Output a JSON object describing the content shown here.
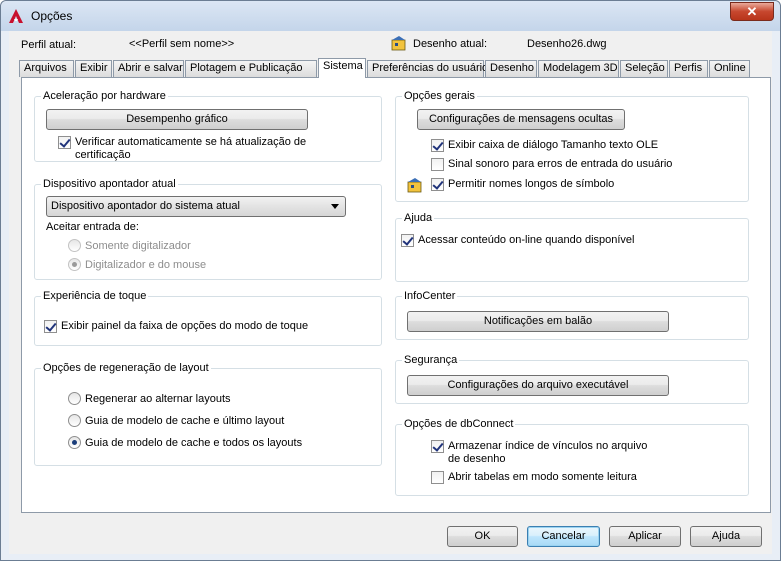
{
  "window": {
    "title": "Opções",
    "close_symbol": "✕",
    "icon": "autocad-icon"
  },
  "header": {
    "profile_label": "Perfil atual:",
    "profile_value": "<<Perfil sem nome>>",
    "drawing_label": "Desenho atual:",
    "drawing_value": "Desenho26.dwg"
  },
  "tabs": [
    {
      "label": "Arquivos"
    },
    {
      "label": "Exibir"
    },
    {
      "label": "Abrir e salvar"
    },
    {
      "label": "Plotagem e Publicação"
    },
    {
      "label": "Sistema",
      "active": true
    },
    {
      "label": "Preferências do usuário"
    },
    {
      "label": "Desenho"
    },
    {
      "label": "Modelagem 3D"
    },
    {
      "label": "Seleção"
    },
    {
      "label": "Perfis"
    },
    {
      "label": "Online"
    }
  ],
  "hardware": {
    "title": "Aceleração por hardware",
    "button": "Desempenho gráfico",
    "check_label": "Verificar automaticamente se há atualização de certificação",
    "checked": true
  },
  "pointing": {
    "title": "Dispositivo apontador atual",
    "selected": "Dispositivo apontador do sistema atual",
    "accept_label": "Aceitar entrada de:",
    "radio1": "Somente digitalizador",
    "radio2": "Digitalizador e do mouse"
  },
  "touch": {
    "title": "Experiência de toque",
    "check_label": "Exibir painel da faixa de opções do modo de toque",
    "checked": true
  },
  "regen": {
    "title": "Opções de regeneração de layout",
    "radio1": "Regenerar ao alternar layouts",
    "radio2": "Guia de modelo de cache e último layout",
    "radio3": "Guia de modelo de cache e todos os layouts"
  },
  "general": {
    "title": "Opções gerais",
    "button": "Configurações de mensagens ocultas",
    "check1": "Exibir caixa de diálogo Tamanho texto OLE",
    "check2": "Sinal sonoro para erros de entrada do usuário",
    "check3": "Permitir nomes longos de símbolo"
  },
  "help": {
    "title": "Ajuda",
    "check_label": "Acessar conteúdo on-line quando disponível"
  },
  "infocenter": {
    "title": "InfoCenter",
    "button": "Notificações em balão"
  },
  "security": {
    "title": "Segurança",
    "button": "Configurações do arquivo executável"
  },
  "dbconnect": {
    "title": "Opções de dbConnect",
    "check1": "Armazenar índice de vínculos no arquivo de desenho",
    "check2": "Abrir tabelas em modo somente leitura"
  },
  "footer": {
    "ok": "OK",
    "cancel": "Cancelar",
    "apply": "Aplicar",
    "help": "Ajuda"
  },
  "colors": {
    "title_bar": "#c4d5ea",
    "close_button": "#c7472e",
    "default_button": "#a7d9f5"
  }
}
